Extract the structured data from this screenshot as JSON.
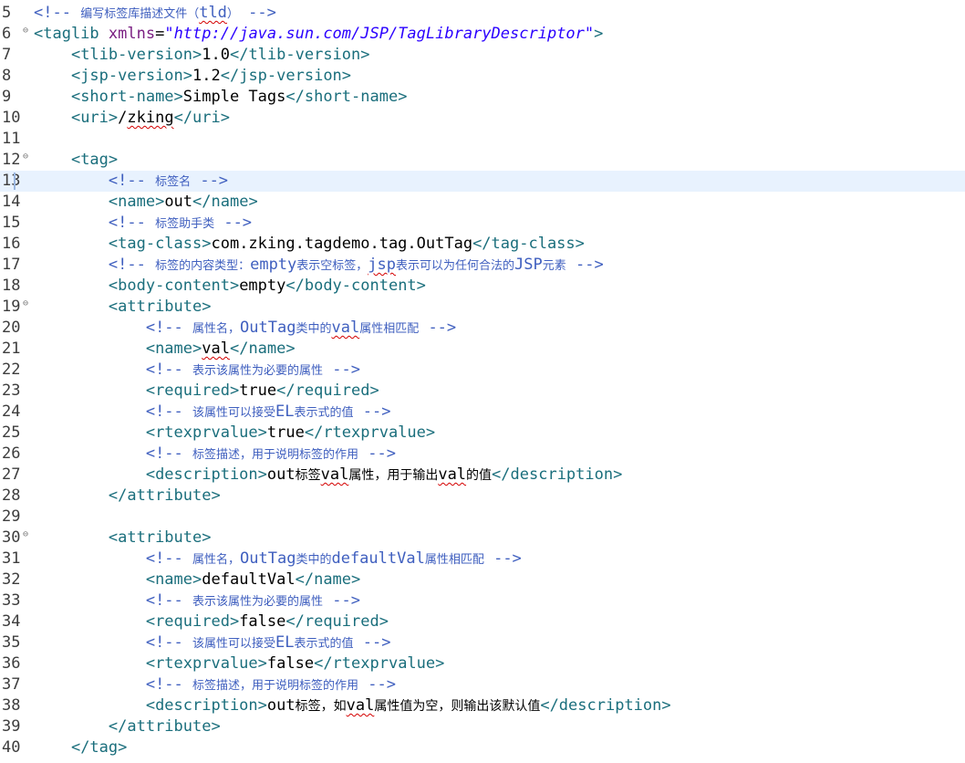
{
  "editor": {
    "current_line": 13,
    "lines": [
      {
        "n": "5",
        "fold": false,
        "indent": 0,
        "tokens": [
          {
            "k": "c",
            "v": "<!-- "
          },
          {
            "k": "c",
            "v": "编写标签库描述文件（",
            "cj": true
          },
          {
            "k": "c",
            "v": "tld",
            "sq": true
          },
          {
            "k": "c",
            "v": "）",
            "cj": true
          },
          {
            "k": "c",
            "v": " -->"
          }
        ]
      },
      {
        "n": "6",
        "fold": true,
        "indent": 0,
        "tokens": [
          {
            "k": "t",
            "v": "<taglib "
          },
          {
            "k": "a",
            "v": "xmlns"
          },
          {
            "k": "x",
            "v": "="
          },
          {
            "k": "s",
            "v": "\"http://java.sun.com/JSP/TagLibraryDescriptor\""
          },
          {
            "k": "t",
            "v": ">"
          }
        ]
      },
      {
        "n": "7",
        "fold": false,
        "indent": 4,
        "tokens": [
          {
            "k": "t",
            "v": "<tlib-version>"
          },
          {
            "k": "x",
            "v": "1.0"
          },
          {
            "k": "t",
            "v": "</tlib-version>"
          }
        ]
      },
      {
        "n": "8",
        "fold": false,
        "indent": 4,
        "tokens": [
          {
            "k": "t",
            "v": "<jsp-version>"
          },
          {
            "k": "x",
            "v": "1.2"
          },
          {
            "k": "t",
            "v": "</jsp-version>"
          }
        ]
      },
      {
        "n": "9",
        "fold": false,
        "indent": 4,
        "tokens": [
          {
            "k": "t",
            "v": "<short-name>"
          },
          {
            "k": "x",
            "v": "Simple Tags"
          },
          {
            "k": "t",
            "v": "</short-name>"
          }
        ]
      },
      {
        "n": "10",
        "fold": false,
        "indent": 4,
        "tokens": [
          {
            "k": "t",
            "v": "<uri>"
          },
          {
            "k": "x",
            "v": "/"
          },
          {
            "k": "x",
            "v": "zking",
            "sq": true
          },
          {
            "k": "t",
            "v": "</uri>"
          }
        ]
      },
      {
        "n": "11",
        "fold": false,
        "indent": 0,
        "tokens": []
      },
      {
        "n": "12",
        "fold": true,
        "indent": 4,
        "tokens": [
          {
            "k": "t",
            "v": "<tag>"
          }
        ]
      },
      {
        "n": "13",
        "fold": false,
        "indent": 8,
        "tokens": [
          {
            "k": "c",
            "v": "<!-- "
          },
          {
            "k": "c",
            "v": "标签名",
            "cj": true
          },
          {
            "k": "c",
            "v": " -->"
          }
        ]
      },
      {
        "n": "14",
        "fold": false,
        "indent": 8,
        "tokens": [
          {
            "k": "t",
            "v": "<name>"
          },
          {
            "k": "x",
            "v": "out"
          },
          {
            "k": "t",
            "v": "</name>"
          }
        ]
      },
      {
        "n": "15",
        "fold": false,
        "indent": 8,
        "tokens": [
          {
            "k": "c",
            "v": "<!-- "
          },
          {
            "k": "c",
            "v": "标签助手类",
            "cj": true
          },
          {
            "k": "c",
            "v": " -->"
          }
        ]
      },
      {
        "n": "16",
        "fold": false,
        "indent": 8,
        "tokens": [
          {
            "k": "t",
            "v": "<tag-class>"
          },
          {
            "k": "x",
            "v": "com.zking.tagdemo.tag.OutTag"
          },
          {
            "k": "t",
            "v": "</tag-class>"
          }
        ]
      },
      {
        "n": "17",
        "fold": false,
        "indent": 8,
        "tokens": [
          {
            "k": "c",
            "v": "<!-- "
          },
          {
            "k": "c",
            "v": "标签的内容类型：",
            "cj": true
          },
          {
            "k": "c",
            "v": "empty"
          },
          {
            "k": "c",
            "v": "表示空标签，",
            "cj": true
          },
          {
            "k": "c",
            "v": "jsp",
            "sq": true
          },
          {
            "k": "c",
            "v": "表示可以为任何合法的",
            "cj": true
          },
          {
            "k": "c",
            "v": "JSP"
          },
          {
            "k": "c",
            "v": "元素",
            "cj": true
          },
          {
            "k": "c",
            "v": " -->"
          }
        ]
      },
      {
        "n": "18",
        "fold": false,
        "indent": 8,
        "tokens": [
          {
            "k": "t",
            "v": "<body-content>"
          },
          {
            "k": "x",
            "v": "empty"
          },
          {
            "k": "t",
            "v": "</body-content>"
          }
        ]
      },
      {
        "n": "19",
        "fold": true,
        "indent": 8,
        "tokens": [
          {
            "k": "t",
            "v": "<attribute>"
          }
        ]
      },
      {
        "n": "20",
        "fold": false,
        "indent": 12,
        "tokens": [
          {
            "k": "c",
            "v": "<!-- "
          },
          {
            "k": "c",
            "v": "属性名，",
            "cj": true
          },
          {
            "k": "c",
            "v": "OutTag"
          },
          {
            "k": "c",
            "v": "类中的",
            "cj": true
          },
          {
            "k": "c",
            "v": "val",
            "sq": true
          },
          {
            "k": "c",
            "v": "属性相匹配",
            "cj": true
          },
          {
            "k": "c",
            "v": " -->"
          }
        ]
      },
      {
        "n": "21",
        "fold": false,
        "indent": 12,
        "tokens": [
          {
            "k": "t",
            "v": "<name>"
          },
          {
            "k": "x",
            "v": "val",
            "sq": true
          },
          {
            "k": "t",
            "v": "</name>"
          }
        ]
      },
      {
        "n": "22",
        "fold": false,
        "indent": 12,
        "tokens": [
          {
            "k": "c",
            "v": "<!-- "
          },
          {
            "k": "c",
            "v": "表示该属性为必要的属性",
            "cj": true
          },
          {
            "k": "c",
            "v": " -->"
          }
        ]
      },
      {
        "n": "23",
        "fold": false,
        "indent": 12,
        "tokens": [
          {
            "k": "t",
            "v": "<required>"
          },
          {
            "k": "x",
            "v": "true"
          },
          {
            "k": "t",
            "v": "</required>"
          }
        ]
      },
      {
        "n": "24",
        "fold": false,
        "indent": 12,
        "tokens": [
          {
            "k": "c",
            "v": "<!-- "
          },
          {
            "k": "c",
            "v": "该属性可以接受",
            "cj": true
          },
          {
            "k": "c",
            "v": "EL"
          },
          {
            "k": "c",
            "v": "表示式的值",
            "cj": true
          },
          {
            "k": "c",
            "v": " -->"
          }
        ]
      },
      {
        "n": "25",
        "fold": false,
        "indent": 12,
        "tokens": [
          {
            "k": "t",
            "v": "<rtexprvalue>"
          },
          {
            "k": "x",
            "v": "true"
          },
          {
            "k": "t",
            "v": "</rtexprvalue>"
          }
        ]
      },
      {
        "n": "26",
        "fold": false,
        "indent": 12,
        "tokens": [
          {
            "k": "c",
            "v": "<!-- "
          },
          {
            "k": "c",
            "v": "标签描述，用于说明标签的作用",
            "cj": true
          },
          {
            "k": "c",
            "v": " -->"
          }
        ]
      },
      {
        "n": "27",
        "fold": false,
        "indent": 12,
        "tokens": [
          {
            "k": "t",
            "v": "<description>"
          },
          {
            "k": "x",
            "v": "out"
          },
          {
            "k": "x",
            "v": "标签",
            "cj": true
          },
          {
            "k": "x",
            "v": "val",
            "sq": true
          },
          {
            "k": "x",
            "v": "属性，用于输出",
            "cj": true
          },
          {
            "k": "x",
            "v": "val",
            "sq": true
          },
          {
            "k": "x",
            "v": "的值",
            "cj": true
          },
          {
            "k": "t",
            "v": "</description>"
          }
        ]
      },
      {
        "n": "28",
        "fold": false,
        "indent": 8,
        "tokens": [
          {
            "k": "t",
            "v": "</attribute>"
          }
        ]
      },
      {
        "n": "29",
        "fold": false,
        "indent": 0,
        "tokens": []
      },
      {
        "n": "30",
        "fold": true,
        "indent": 8,
        "tokens": [
          {
            "k": "t",
            "v": "<attribute>"
          }
        ]
      },
      {
        "n": "31",
        "fold": false,
        "indent": 12,
        "tokens": [
          {
            "k": "c",
            "v": "<!-- "
          },
          {
            "k": "c",
            "v": "属性名，",
            "cj": true
          },
          {
            "k": "c",
            "v": "OutTag"
          },
          {
            "k": "c",
            "v": "类中的",
            "cj": true
          },
          {
            "k": "c",
            "v": "defaultVal"
          },
          {
            "k": "c",
            "v": "属性相匹配",
            "cj": true
          },
          {
            "k": "c",
            "v": " -->"
          }
        ]
      },
      {
        "n": "32",
        "fold": false,
        "indent": 12,
        "tokens": [
          {
            "k": "t",
            "v": "<name>"
          },
          {
            "k": "x",
            "v": "defaultVal"
          },
          {
            "k": "t",
            "v": "</name>"
          }
        ]
      },
      {
        "n": "33",
        "fold": false,
        "indent": 12,
        "tokens": [
          {
            "k": "c",
            "v": "<!-- "
          },
          {
            "k": "c",
            "v": "表示该属性为必要的属性",
            "cj": true
          },
          {
            "k": "c",
            "v": " -->"
          }
        ]
      },
      {
        "n": "34",
        "fold": false,
        "indent": 12,
        "tokens": [
          {
            "k": "t",
            "v": "<required>"
          },
          {
            "k": "x",
            "v": "false"
          },
          {
            "k": "t",
            "v": "</required>"
          }
        ]
      },
      {
        "n": "35",
        "fold": false,
        "indent": 12,
        "tokens": [
          {
            "k": "c",
            "v": "<!-- "
          },
          {
            "k": "c",
            "v": "该属性可以接受",
            "cj": true
          },
          {
            "k": "c",
            "v": "EL"
          },
          {
            "k": "c",
            "v": "表示式的值",
            "cj": true
          },
          {
            "k": "c",
            "v": " -->"
          }
        ]
      },
      {
        "n": "36",
        "fold": false,
        "indent": 12,
        "tokens": [
          {
            "k": "t",
            "v": "<rtexprvalue>"
          },
          {
            "k": "x",
            "v": "false"
          },
          {
            "k": "t",
            "v": "</rtexprvalue>"
          }
        ]
      },
      {
        "n": "37",
        "fold": false,
        "indent": 12,
        "tokens": [
          {
            "k": "c",
            "v": "<!-- "
          },
          {
            "k": "c",
            "v": "标签描述，用于说明标签的作用",
            "cj": true
          },
          {
            "k": "c",
            "v": " -->"
          }
        ]
      },
      {
        "n": "38",
        "fold": false,
        "indent": 12,
        "tokens": [
          {
            "k": "t",
            "v": "<description>"
          },
          {
            "k": "x",
            "v": "out"
          },
          {
            "k": "x",
            "v": "标签，如",
            "cj": true
          },
          {
            "k": "x",
            "v": "val",
            "sq": true
          },
          {
            "k": "x",
            "v": "属性值为空，则输出该默认值",
            "cj": true
          },
          {
            "k": "t",
            "v": "</description>"
          }
        ]
      },
      {
        "n": "39",
        "fold": false,
        "indent": 8,
        "tokens": [
          {
            "k": "t",
            "v": "</attribute>"
          }
        ]
      },
      {
        "n": "40",
        "fold": false,
        "indent": 4,
        "tokens": [
          {
            "k": "t",
            "v": "</tag>"
          }
        ]
      }
    ]
  },
  "icons": {
    "fold": "fold-collapse-icon"
  }
}
